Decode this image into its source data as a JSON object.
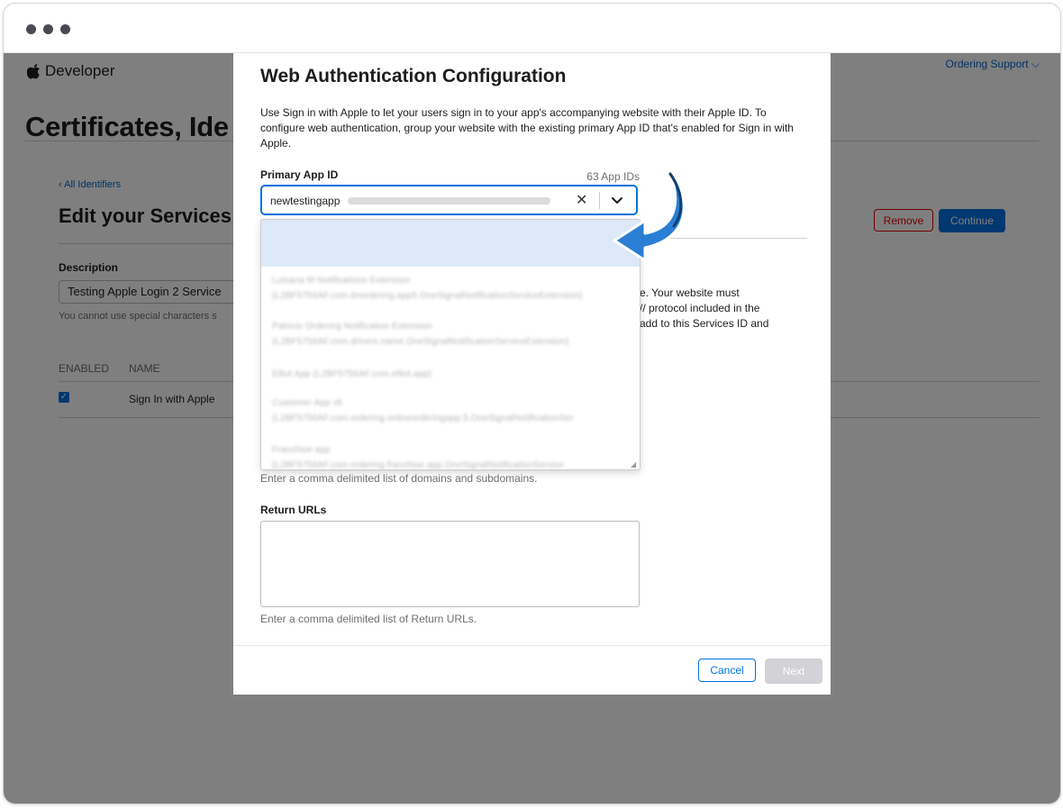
{
  "site": {
    "brand": "Developer",
    "ordering_support": "Ordering Support ⌵"
  },
  "page": {
    "title": "Certificates, Ide",
    "back_link": "‹ All Identifiers",
    "edit_title": "Edit your Services",
    "remove_label": "Remove",
    "continue_label": "Continue",
    "description_label": "Description",
    "description_value": "Testing Apple Login 2 Service",
    "description_hint": "You cannot use special characters s",
    "col_enabled": "ENABLED",
    "col_name": "NAME",
    "row_name": "Sign In with Apple"
  },
  "modal": {
    "title": "Web Authentication Configuration",
    "intro": "Use Sign in with Apple to let your users sign in to your app's accompanying website with their Apple ID. To configure web authentication, group your website with the existing primary App ID that's enabled for Sign in with Apple.",
    "primary_label": "Primary App ID",
    "app_id_count": "63 App IDs",
    "combo_value": "newtestingapp",
    "clear_glyph": "✕",
    "options": [
      {
        "line1": "Luisana M Notifications Extension",
        "line2": "(L2BF5756AF.com.itnordering.app5.OneSignalNotificationServiceExtension)"
      },
      {
        "line1": "Patricio Ordering Notification Extension",
        "line2": "(L2BF5756AF.com.drivers.name.OneSignalNotificationServiceExtension)"
      },
      {
        "line1": "Elliot App (L2BF5756AF.com.elliot.app)",
        "line2": ""
      },
      {
        "line1": "Customer App v5",
        "line2": "(L2BF5756AF.com.ordering.onlineorderingapp.5.OneSignalNotificationSer"
      },
      {
        "line1": "Franchise app",
        "line2": "(L2BF5756AF.com.ordering.franchise.app.OneSignalNotificationService"
      }
    ],
    "bg_text_a": "e. Your website must",
    "bg_text_b": "// protocol included in the",
    "bg_text_c": "add to this Services ID and",
    "domains_hint": "Enter a comma delimited list of domains and subdomains.",
    "return_label": "Return URLs",
    "return_value": "",
    "return_hint": "Enter a comma delimited list of Return URLs.",
    "cancel_label": "Cancel",
    "next_label": "Next"
  },
  "colors": {
    "accent": "#0071e3",
    "danger": "#e30000",
    "highlight": "#dde9f8",
    "annotation_arrow": "#2a7fd4"
  },
  "icons": [
    "apple-logo-icon",
    "clear-icon",
    "chevron-down-icon",
    "checkbox-checked-icon",
    "curved-arrow-icon"
  ]
}
